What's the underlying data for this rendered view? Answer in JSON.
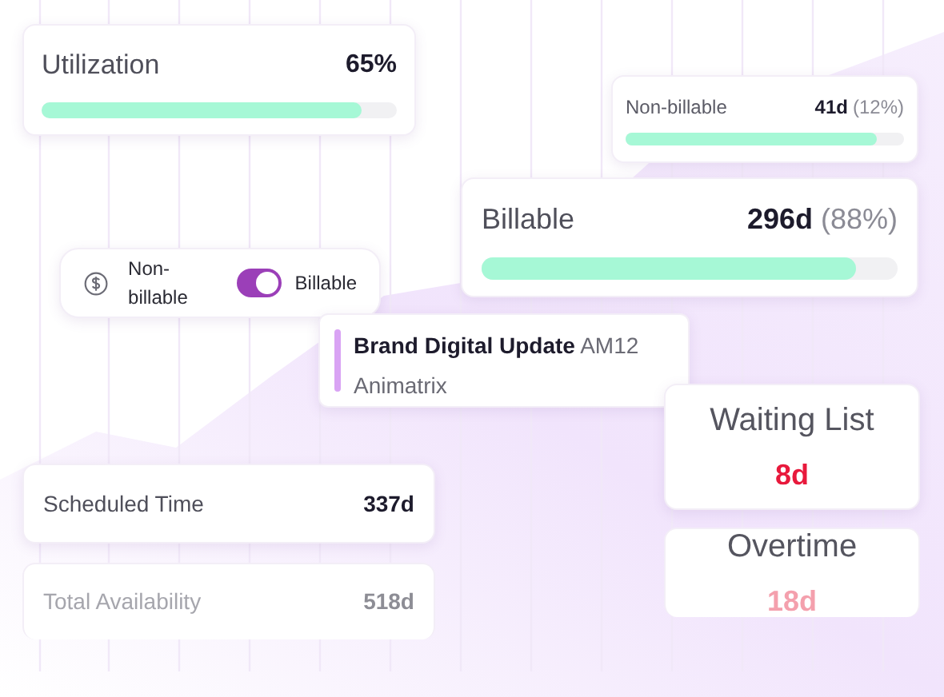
{
  "utilization": {
    "label": "Utilization",
    "value": "65%",
    "level": 0.9
  },
  "non_billable": {
    "label": "Non-billable",
    "value": "41d",
    "share": "(12%)",
    "level": 0.9
  },
  "billable": {
    "label": "Billable",
    "value": "296d",
    "share": "(88%)",
    "level": 0.9
  },
  "billing_toggle": {
    "off_label": "Non-billable",
    "on_label": "Billable",
    "on": true
  },
  "project": {
    "title": "**Brand Digital Update** AM12",
    "client": "Animatrix"
  },
  "stats": [
    {
      "label": "Waiting List",
      "value": "8d",
      "color": "#e8193c"
    },
    {
      "label": "Overtime",
      "value": "18d",
      "color": "#f4a0ad"
    }
  ],
  "totals": [
    {
      "label": "Scheduled Time",
      "value": "337d",
      "faded": false
    },
    {
      "label": "Total Availability",
      "value": "518d",
      "faded": true
    }
  ]
}
